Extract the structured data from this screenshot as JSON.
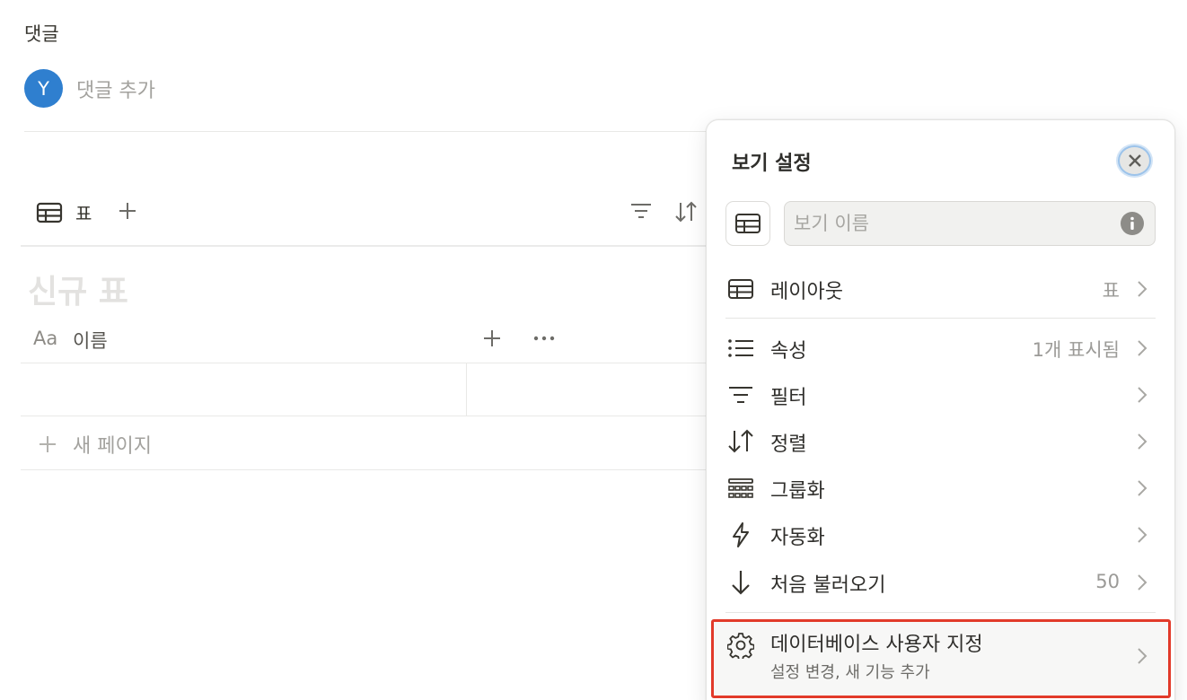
{
  "comments": {
    "label": "댓글",
    "avatar_initial": "Y",
    "placeholder": "댓글 추가"
  },
  "toolbar": {
    "view_tab_label": "표"
  },
  "table": {
    "title": "신규 표",
    "name_column_icon": "Aa",
    "name_column_label": "이름",
    "new_page_label": "새 페이지"
  },
  "panel": {
    "title": "보기 설정",
    "name_placeholder": "보기 이름",
    "rows": {
      "layout": {
        "label": "레이아웃",
        "value": "표"
      },
      "properties": {
        "label": "속성",
        "value": "1개 표시됨"
      },
      "filter": {
        "label": "필터"
      },
      "sort": {
        "label": "정렬"
      },
      "group": {
        "label": "그룹화"
      },
      "automation": {
        "label": "자동화"
      },
      "load_limit": {
        "label": "처음 불러오기",
        "value": "50"
      }
    },
    "customize": {
      "label": "데이터베이스 사용자 지정",
      "sublabel": "설정 변경, 새 기능 추가"
    }
  },
  "colors": {
    "avatar": "#2f7fcf",
    "highlight_border": "#e23a2a",
    "focus_ring": "#9cc3ea"
  },
  "icons": [
    "table-icon",
    "plus-icon",
    "filter-icon",
    "sort-icon",
    "more-icon",
    "close-icon",
    "info-icon",
    "list-icon",
    "group-icon",
    "lightning-icon",
    "arrow-down-icon",
    "gear-icon",
    "chevron-right-icon"
  ]
}
